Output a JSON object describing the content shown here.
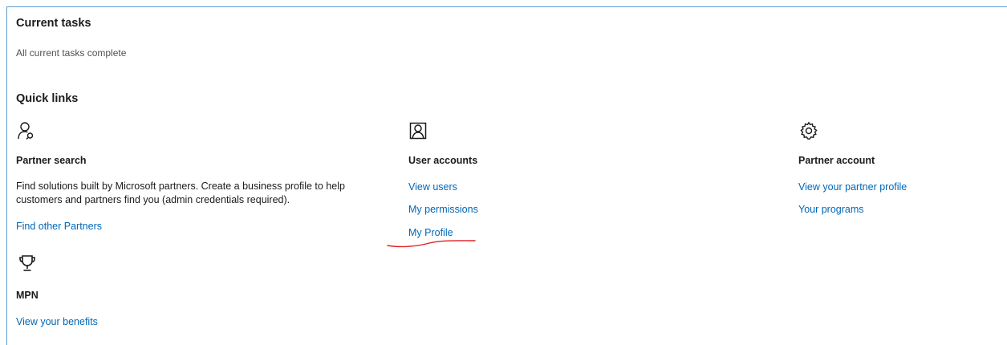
{
  "current_tasks": {
    "heading": "Current tasks",
    "status": "All current tasks complete"
  },
  "quick_links": {
    "heading": "Quick links",
    "partner_search": {
      "icon": "person-search-icon",
      "title": "Partner search",
      "description": "Find solutions built by Microsoft partners. Create a business profile to help customers and partners find you (admin credentials required).",
      "links": [
        "Find other Partners"
      ]
    },
    "user_accounts": {
      "icon": "contact-card-icon",
      "title": "User accounts",
      "links": [
        "View users",
        "My permissions",
        "My Profile"
      ]
    },
    "partner_account": {
      "icon": "gear-icon",
      "title": "Partner account",
      "links": [
        "View your partner profile",
        "Your programs"
      ]
    },
    "mpn": {
      "icon": "trophy-icon",
      "title": "MPN",
      "links": [
        "View your benefits"
      ]
    }
  },
  "colors": {
    "link": "#0067b8",
    "annotation": "#e02020",
    "frame_border": "#5b9bd5"
  }
}
